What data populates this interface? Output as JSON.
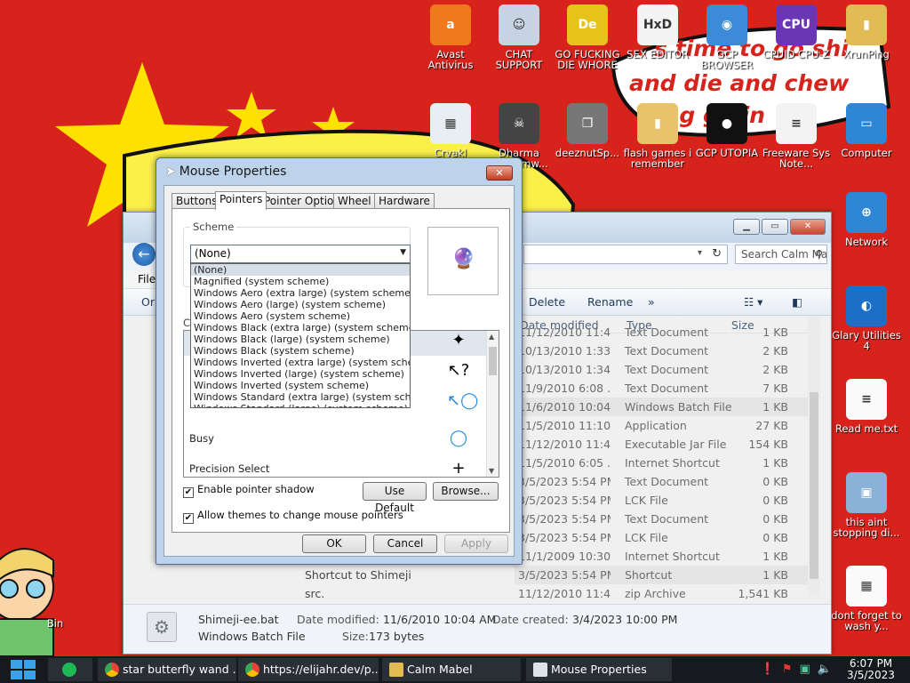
{
  "desktop": {
    "wallpaper_text": [
      "it's time to go shi",
      "and die and chew",
      "ing gillin"
    ],
    "icons": [
      {
        "label": "Avast Antivirus",
        "icon": "avast-icon",
        "color": "#f07a1b",
        "glyph": "a"
      },
      {
        "label": "CHAT SUPPORT",
        "icon": "doctor-icon",
        "color": "#c7d3e2",
        "glyph": "☺"
      },
      {
        "label": "GO FUCKING DIE WHORE",
        "icon": "de-logo-icon",
        "color": "#e7c21b",
        "glyph": "De"
      },
      {
        "label": "SEX EDITOR",
        "icon": "hxd-icon",
        "color": "#f4f4f4",
        "glyph": "HxD"
      },
      {
        "label": "GCP BROWSER",
        "icon": "chrome-icon",
        "color": "#3c8bd9",
        "glyph": "◉"
      },
      {
        "label": "CPUID CPU-Z",
        "icon": "cpuz-icon",
        "color": "#6a36b5",
        "glyph": "CPU"
      },
      {
        "label": "XrunPing",
        "icon": "folder-user-icon",
        "color": "#e3bb55",
        "glyph": "▮"
      },
      {
        "label": "Cryakl",
        "icon": "app-window-icon",
        "color": "#e9eef3",
        "glyph": "▦"
      },
      {
        "label": "Dharma Ransomw...",
        "icon": "skull-icon",
        "color": "#444",
        "glyph": "☠"
      },
      {
        "label": "deeznutSp...",
        "icon": "windows-stack-icon",
        "color": "#777",
        "glyph": "❐"
      },
      {
        "label": "flash games i remember",
        "icon": "folder-icon",
        "color": "#e8c36a",
        "glyph": "▮"
      },
      {
        "label": "GCP UTOPIA",
        "icon": "utopia-icon",
        "color": "#111",
        "glyph": "●"
      },
      {
        "label": "Freeware Sys Note...",
        "icon": "document-icon",
        "color": "#f3f3f3",
        "glyph": "≡"
      },
      {
        "label": "Computer",
        "icon": "computer-icon",
        "color": "#2f86d6",
        "glyph": "▭"
      },
      {
        "label": "Network",
        "icon": "network-icon",
        "color": "#2f86d6",
        "glyph": "⊕"
      },
      {
        "label": "Glary Utilities 4",
        "icon": "glary-icon",
        "color": "#1b6fc7",
        "glyph": "◐"
      },
      {
        "label": "Read me.txt",
        "icon": "text-file-icon",
        "color": "#fafafa",
        "glyph": "≡"
      },
      {
        "label": "this aint stopping di...",
        "icon": "install-icon",
        "color": "#8ab1d6",
        "glyph": "▣"
      },
      {
        "label": "dont forget to wash y...",
        "icon": "calendar-icon",
        "color": "#fafafa",
        "glyph": "▦"
      },
      {
        "label": "Bin",
        "icon": "recycle-bin-icon",
        "color": "#d23",
        "glyph": ""
      }
    ]
  },
  "explorer": {
    "title": "Calm Mabel",
    "search_placeholder": "Search Calm Mabel",
    "menu_file": "File",
    "nav_truncated": "Or",
    "toolbar": {
      "delete": "Delete",
      "rename": "Rename",
      "more": "»"
    },
    "columns": {
      "date": "Date modified",
      "type": "Type",
      "size": "Size"
    },
    "rows": [
      {
        "name": "",
        "date": "11/12/2010 11:4...",
        "type": "Text Document",
        "size": "1 KB"
      },
      {
        "name": "",
        "date": "10/13/2010 1:33...",
        "type": "Text Document",
        "size": "2 KB"
      },
      {
        "name": "",
        "date": "10/13/2010 1:34...",
        "type": "Text Document",
        "size": "2 KB"
      },
      {
        "name": "",
        "date": "11/9/2010 6:08 ...",
        "type": "Text Document",
        "size": "7 KB"
      },
      {
        "name": "",
        "date": "11/6/2010 10:04...",
        "type": "Windows Batch File",
        "size": "1 KB"
      },
      {
        "name": "",
        "date": "11/5/2010 11:10...",
        "type": "Application",
        "size": "27 KB"
      },
      {
        "name": "",
        "date": "11/12/2010 11:4...",
        "type": "Executable Jar File",
        "size": "154 KB"
      },
      {
        "name": "",
        "date": "11/5/2010 6:05 ...",
        "type": "Internet Shortcut",
        "size": "1 KB"
      },
      {
        "name": "",
        "date": "3/5/2023 5:54 PM",
        "type": "Text Document",
        "size": "0 KB"
      },
      {
        "name": "",
        "date": "3/5/2023 5:54 PM",
        "type": "LCK File",
        "size": "0 KB"
      },
      {
        "name": "",
        "date": "3/5/2023 5:54 PM",
        "type": "Text Document",
        "size": "0 KB"
      },
      {
        "name": "",
        "date": "3/5/2023 5:54 PM",
        "type": "LCK File",
        "size": "0 KB"
      },
      {
        "name": "",
        "date": "11/1/2009 10:30 ...",
        "type": "Internet Shortcut",
        "size": "1 KB"
      },
      {
        "name": "Shortcut to Shimeji",
        "date": "3/5/2023 5:54 PM",
        "type": "Shortcut",
        "size": "1 KB"
      },
      {
        "name": "src.",
        "date": "11/12/2010 11:4...",
        "type": "zip Archive",
        "size": "1,541 KB"
      }
    ],
    "details": {
      "filename": "Shimeji-ee.bat",
      "filetype": "Windows Batch File",
      "modified_label": "Date modified:",
      "modified_value": "11/6/2010 10:04 AM",
      "created_label": "Date created:",
      "created_value": "3/4/2023 10:00 PM",
      "size_label": "Size:",
      "size_value": "173 bytes"
    }
  },
  "mouse_dialog": {
    "title": "Mouse Properties",
    "tabs": [
      "Buttons",
      "Pointers",
      "Pointer Options",
      "Wheel",
      "Hardware"
    ],
    "active_tab": "Pointers",
    "scheme_label": "Scheme",
    "scheme_value": "(None)",
    "scheme_options": [
      "(None)",
      "Magnified (system scheme)",
      "Windows Aero (extra large) (system scheme)",
      "Windows Aero (large) (system scheme)",
      "Windows Aero (system scheme)",
      "Windows Black (extra large) (system scheme)",
      "Windows Black (large) (system scheme)",
      "Windows Black (system scheme)",
      "Windows Inverted (extra large) (system scheme)",
      "Windows Inverted (large) (system scheme)",
      "Windows Inverted (system scheme)",
      "Windows Standard (extra large) (system scheme)",
      "Windows Standard (large) (system scheme)"
    ],
    "customize_label": "C",
    "cursor_rows": [
      {
        "label": "",
        "icon": "star-wand-cursor-icon",
        "glyph": "✦"
      },
      {
        "label": "",
        "icon": "help-select-cursor-icon",
        "glyph": "↖?"
      },
      {
        "label": "",
        "icon": "working-in-background-cursor-icon",
        "glyph": "↖◯"
      },
      {
        "label": "Busy",
        "icon": "busy-ring-icon",
        "glyph": "◯"
      },
      {
        "label": "Precision Select",
        "icon": "crosshair-icon",
        "glyph": "+"
      }
    ],
    "pointer_shadow_label": "Enable pointer shadow",
    "themes_label": "Allow themes to change mouse pointers",
    "use_default": "Use Default",
    "browse": "Browse...",
    "ok": "OK",
    "cancel": "Cancel",
    "apply": "Apply"
  },
  "taskbar": {
    "tasks": [
      {
        "label": "star butterfly wand ...",
        "icon": "chrome-icon"
      },
      {
        "label": "https://elijahr.dev/p...",
        "icon": "chrome-icon"
      },
      {
        "label": "Calm Mabel",
        "icon": "folder-icon"
      },
      {
        "label": "Mouse Properties",
        "icon": "mouse-pointer-icon"
      }
    ],
    "time": "6:07 PM",
    "date": "3/5/2023"
  }
}
